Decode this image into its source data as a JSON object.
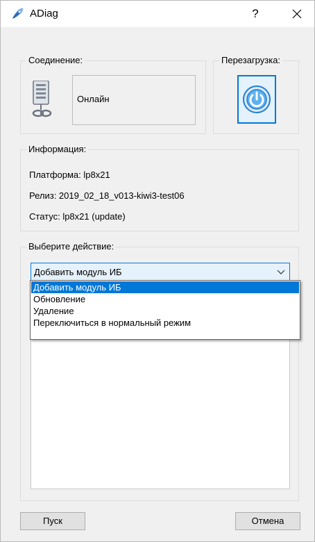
{
  "window": {
    "title": "ADiag",
    "help_label": "?",
    "app_icon": "rocket-icon",
    "close_icon": "close-icon"
  },
  "connection": {
    "group_title": "Соединение:",
    "status": "Онлайн",
    "icon": "server-icon"
  },
  "reboot": {
    "group_title": "Перезагрузка:",
    "icon": "power-icon"
  },
  "info": {
    "group_title": "Информация:",
    "platform": "Платформа: lp8x21",
    "release": "Релиз: 2019_02_18_v013-kiwi3-test06",
    "status": "Статус: lp8x21 (update)"
  },
  "action": {
    "group_title": "Выберите действие:",
    "selected": "Добавить модуль ИБ",
    "options": [
      "Добавить модуль ИБ",
      "Обновление",
      "Удаление",
      "Переключиться в нормальный режим"
    ]
  },
  "buttons": {
    "start": "Пуск",
    "cancel": "Отмена"
  },
  "colors": {
    "accent": "#0078d7",
    "window_bg": "#f0f0f0",
    "selection_text": "#ffffff"
  }
}
